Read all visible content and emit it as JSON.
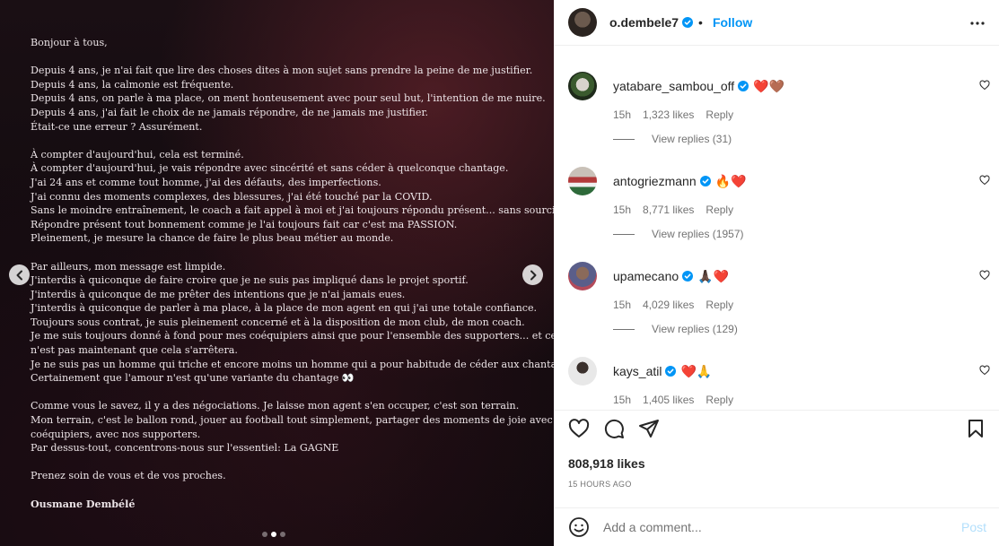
{
  "post": {
    "letter": {
      "greeting": "Bonjour à tous,",
      "para1": [
        "Depuis 4 ans, je n'ai fait que lire des choses dites à mon sujet sans prendre la peine de me justifier.",
        "Depuis 4 ans, la calmonie est fréquente.",
        "Depuis 4 ans, on parle à ma place, on ment honteusement avec pour seul but, l'intention de me nuire.",
        "Depuis 4 ans, j'ai fait le choix de ne jamais répondre, de ne jamais me justifier.",
        "Était-ce une erreur ? Assurément."
      ],
      "para2": [
        "À compter d'aujourd'hui, cela est terminé.",
        "À compter d'aujourd'hui, je vais répondre avec sincérité et sans céder à quelconque chantage.",
        "J'ai 24 ans et comme tout homme, j'ai des défauts, des imperfections.",
        "J'ai connu des moments complexes, des blessures, j'ai été touché par la COVID.",
        "Sans le moindre entraînement, le coach a fait appel à moi et j'ai toujours répondu présent... sans sourciller.",
        "Répondre présent tout bonnement comme je l'ai toujours fait car c'est ma PASSION.",
        "Pleinement, je mesure la chance de faire le plus beau métier au monde."
      ],
      "para3": [
        "Par ailleurs, mon message est limpide.",
        "J'interdis à quiconque de faire croire que je ne suis pas impliqué dans le projet sportif.",
        "J'interdis à quiconque de me prêter des intentions que je n'ai jamais eues.",
        "J'interdis à quiconque de parler à ma place, à la place de mon agent en qui j'ai une totale confiance.",
        "Toujours sous contrat, je suis pleinement concerné et à la disposition de mon club, de mon coach.",
        "Je me suis toujours donné à fond pour mes coéquipiers ainsi que pour l'ensemble des supporters... et ce",
        "n'est pas maintenant que cela s'arrêtera.",
        "Je ne suis pas un homme qui triche et encore moins un homme qui a pour habitude de céder aux chantages.",
        "Certainement que l'amour n'est qu'une variante du chantage 👀"
      ],
      "para4": [
        "Comme vous le savez, il y a des négociations. Je laisse mon agent s'en occuper, c'est son terrain.",
        "Mon terrain, c'est le ballon rond, jouer au football tout simplement, partager des moments de joie avec mes",
        "coéquipiers, avec nos supporters.",
        "Par dessus-tout, concentrons-nous sur l'essentiel: La GAGNE"
      ],
      "closing": "Prenez soin de vous et de vos proches.",
      "signature": "Ousmane Dembélé"
    },
    "carousel": {
      "count": 3,
      "active_index": 1
    }
  },
  "header": {
    "username": "o.dembele7",
    "separator": "•",
    "follow_label": "Follow"
  },
  "comments": [
    {
      "username": "yatabare_sambou_off",
      "text": "❤️🤎",
      "time": "15h",
      "likes": "1,323 likes",
      "reply": "Reply",
      "view_replies": "View replies (31)"
    },
    {
      "username": "antogriezmann",
      "text": "🔥❤️",
      "time": "15h",
      "likes": "8,771 likes",
      "reply": "Reply",
      "view_replies": "View replies (1957)"
    },
    {
      "username": "upamecano",
      "text": "🙏🏿❤️",
      "time": "15h",
      "likes": "4,029 likes",
      "reply": "Reply",
      "view_replies": "View replies (129)"
    },
    {
      "username": "kays_atil",
      "text": "❤️🙏",
      "time": "15h",
      "likes": "1,405 likes",
      "reply": "Reply"
    }
  ],
  "stats": {
    "likes": "808,918 likes",
    "time": "15 HOURS AGO"
  },
  "composer": {
    "placeholder": "Add a comment...",
    "post_label": "Post"
  },
  "colors": {
    "accent": "#0095f6",
    "verified": "#0095f6",
    "post_disabled": "#b2dffc"
  }
}
